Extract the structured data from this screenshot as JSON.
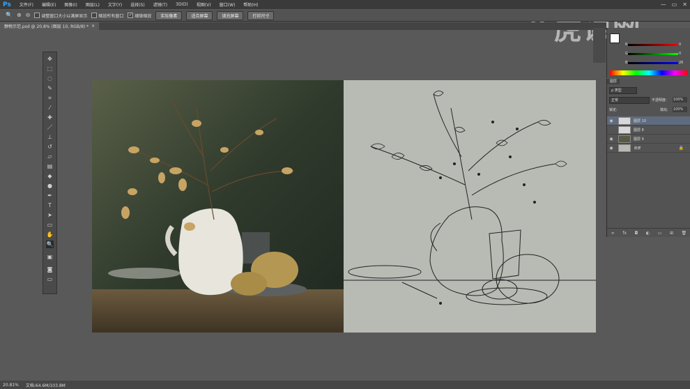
{
  "app": {
    "logo": "Ps"
  },
  "menu": [
    "文件(F)",
    "编辑(E)",
    "图像(I)",
    "图层(L)",
    "文字(Y)",
    "选择(S)",
    "滤镜(T)",
    "3D(D)",
    "视图(V)",
    "窗口(W)",
    "帮助(H)"
  ],
  "window_controls": {
    "min": "—",
    "max": "▭",
    "close": "✕"
  },
  "options": {
    "resize_windows": "调整窗口大小以满屏显示",
    "zoom_all": "缩放所有窗口",
    "scrubby_zoom": "细微缩放",
    "btn_actual": "实际像素",
    "btn_fit": "适合屏幕",
    "btn_fill": "填充屏幕",
    "btn_print": "打印尺寸"
  },
  "document_tab": {
    "title": "静物示范.psd @ 20.8% (图层 10, RGB/8) *",
    "close": "×"
  },
  "color_panel": {
    "labels": [
      "R",
      "G",
      "B"
    ],
    "values": [
      "0",
      "0",
      "26"
    ]
  },
  "layers_panel": {
    "tab": "图层",
    "filter": "ρ 类型",
    "blend_mode": "正常",
    "opacity_label": "不透明度:",
    "opacity_value": "100%",
    "lock_label": "锁定:",
    "fill_label": "填充:",
    "fill_value": "100%",
    "layers": [
      {
        "name": "图层 10",
        "visible": true,
        "selected": true
      },
      {
        "name": "图层 8",
        "visible": false,
        "selected": false
      },
      {
        "name": "图层 9",
        "visible": true,
        "selected": false
      },
      {
        "name": "背景",
        "visible": true,
        "selected": false
      }
    ]
  },
  "status": {
    "zoom": "20.81%",
    "doc": "文档:64.6M/103.8M"
  },
  "watermark": {
    "text": "虎课网",
    "prefix": "lE"
  }
}
